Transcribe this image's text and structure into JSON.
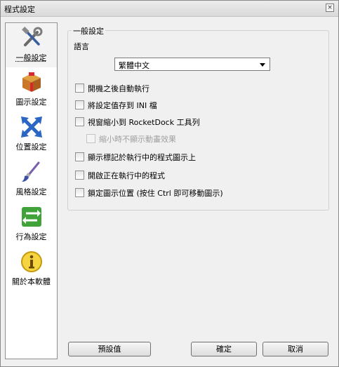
{
  "window": {
    "title": "程式設定",
    "close_label": "×"
  },
  "sidebar": {
    "items": [
      {
        "label": "一般設定",
        "icon": "tools-icon",
        "selected": true
      },
      {
        "label": "圖示設定",
        "icon": "box-icon",
        "selected": false
      },
      {
        "label": "位置設定",
        "icon": "arrows-icon",
        "selected": false
      },
      {
        "label": "風格設定",
        "icon": "brush-icon",
        "selected": false
      },
      {
        "label": "行為設定",
        "icon": "exchange-icon",
        "selected": false
      },
      {
        "label": "關於本軟體",
        "icon": "info-icon",
        "selected": false
      }
    ]
  },
  "general": {
    "group_title": "一般設定",
    "language_label": "語言",
    "language_value": "繁體中文",
    "options": [
      {
        "label": "開機之後自動執行",
        "checked": false,
        "enabled": true
      },
      {
        "label": "將設定值存到 INI 檔",
        "checked": false,
        "enabled": true
      },
      {
        "label": "視窗縮小到 RocketDock 工具列",
        "checked": false,
        "enabled": true
      },
      {
        "label": "縮小時不顯示動畫效果",
        "checked": false,
        "enabled": false
      },
      {
        "label": "顯示標記於執行中的程式圖示上",
        "checked": false,
        "enabled": true
      },
      {
        "label": "開啟正在執行中的程式",
        "checked": false,
        "enabled": true
      },
      {
        "label": "鎖定圖示位置 (按住 Ctrl 即可移動圖示)",
        "checked": false,
        "enabled": true
      }
    ]
  },
  "buttons": {
    "defaults": "預設值",
    "ok": "確定",
    "cancel": "取消"
  },
  "colors": {
    "window_bg": "#f0f0f0",
    "border": "#8e8e8e"
  }
}
